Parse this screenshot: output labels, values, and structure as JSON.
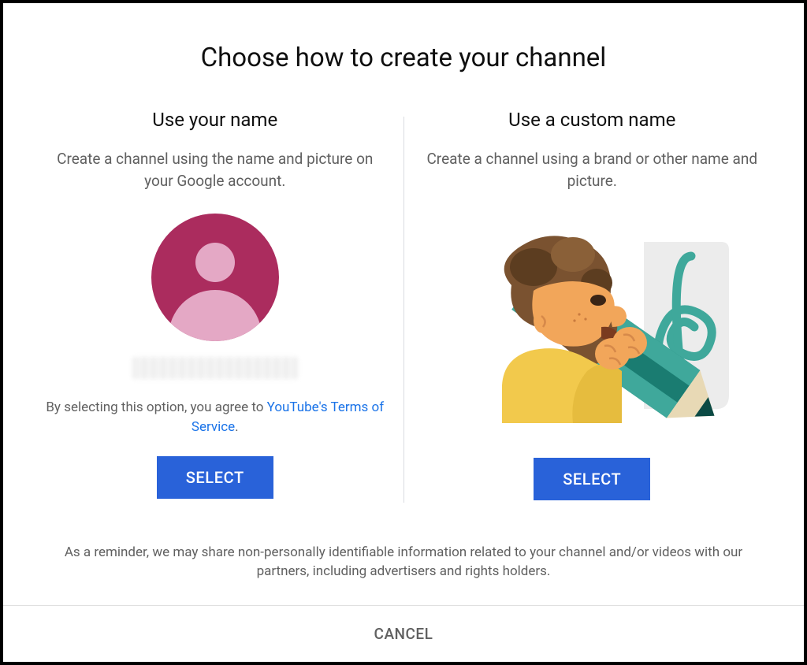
{
  "title": "Choose how to create your channel",
  "options": {
    "own": {
      "heading": "Use your name",
      "description": "Create a channel using the name and picture on your Google account.",
      "terms_prefix": "By selecting this option, you agree to ",
      "terms_link": "YouTube's Terms of Service",
      "terms_suffix": ".",
      "select_label": "SELECT"
    },
    "custom": {
      "heading": "Use a custom name",
      "description": "Create a channel using a brand or other name and picture.",
      "select_label": "SELECT"
    }
  },
  "reminder": "As a reminder, we may share non-personally identifiable information related to your channel and/or videos with our partners, including advertisers and rights holders.",
  "cancel_label": "CANCEL"
}
